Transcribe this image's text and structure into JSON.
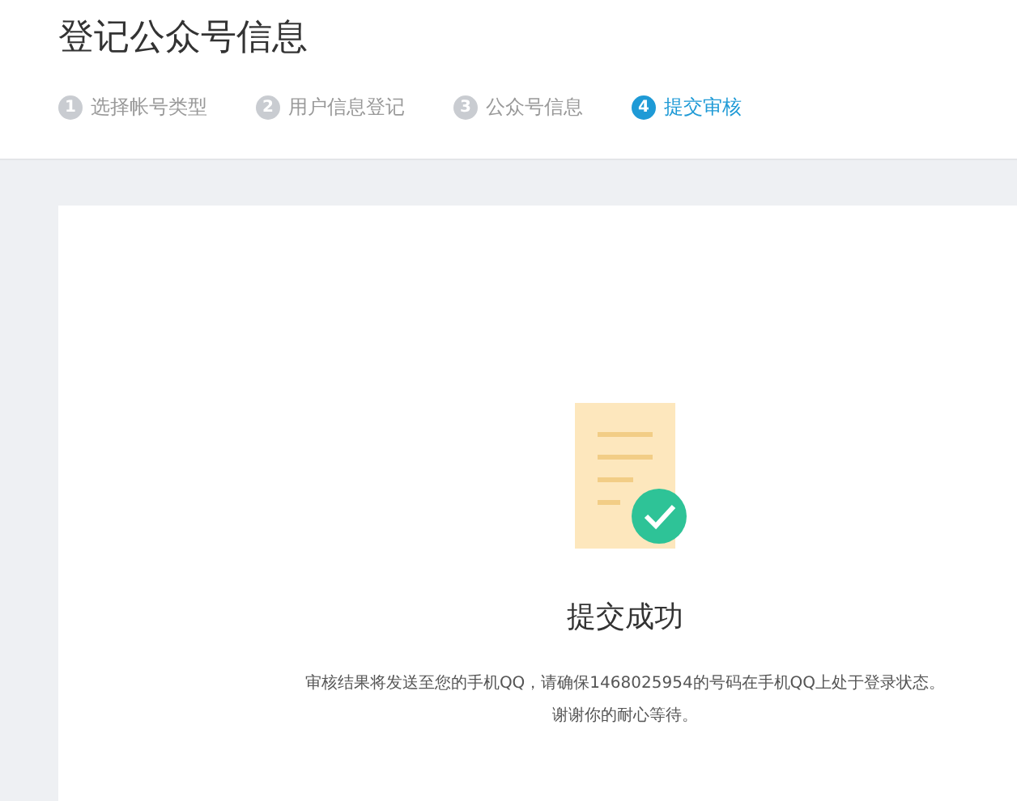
{
  "title": "登记公众号信息",
  "steps": [
    {
      "number": "1",
      "label": "选择帐号类型",
      "selected": false
    },
    {
      "number": "2",
      "label": "用户信息登记",
      "selected": false
    },
    {
      "number": "3",
      "label": "公众号信息",
      "selected": false
    },
    {
      "number": "4",
      "label": "提交审核",
      "selected": true
    }
  ],
  "result": {
    "heading": "提交成功",
    "message": "审核结果将发送至您的手机QQ，请确保1468025954的号码在手机QQ上处于登录状态。",
    "note": "谢谢你的耐心等待。"
  }
}
